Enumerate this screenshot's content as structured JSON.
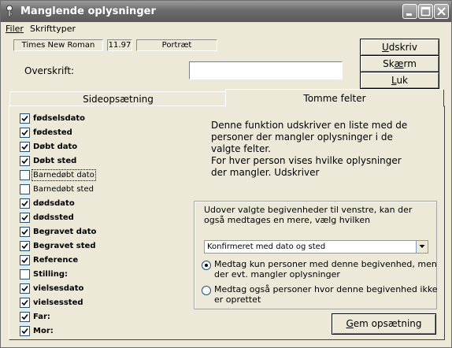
{
  "window": {
    "title": "Manglende oplysninger",
    "controls": [
      "minimize-icon",
      "maximize-icon",
      "close-icon"
    ]
  },
  "menu": [
    "Filer",
    "Skrifttyper"
  ],
  "font_info": {
    "name": "Times New Roman",
    "size": "11.97",
    "orientation": "Portræt"
  },
  "heading": {
    "label": "Overskrift:",
    "value": ""
  },
  "buttons": {
    "print": {
      "underlined": "U",
      "rest": "dskriv"
    },
    "screen": {
      "pre": "Sk",
      "underlined": "æ",
      "rest": "rm"
    },
    "close": {
      "underlined": "L",
      "rest": "uk"
    },
    "save": {
      "underlined": "G",
      "rest": "em opsætning"
    }
  },
  "tabs": [
    {
      "label": "Sideopsætning",
      "active": false
    },
    {
      "label": "Tomme felter",
      "active": true
    }
  ],
  "fields": [
    {
      "label": "fødselsdato",
      "checked": true,
      "bold": true
    },
    {
      "label": "fødested",
      "checked": true,
      "bold": true
    },
    {
      "label": "Døbt dato",
      "checked": true,
      "bold": true
    },
    {
      "label": "Døbt sted",
      "checked": true,
      "bold": true
    },
    {
      "label": "Barnedøbt dato",
      "checked": false,
      "bold": false,
      "focused": true
    },
    {
      "label": "Barnedøbt sted",
      "checked": false,
      "bold": false
    },
    {
      "label": "dødsdato",
      "checked": true,
      "bold": true
    },
    {
      "label": "dødssted",
      "checked": true,
      "bold": true
    },
    {
      "label": "Begravet dato",
      "checked": true,
      "bold": true
    },
    {
      "label": "Begravet sted",
      "checked": true,
      "bold": true
    },
    {
      "label": "Reference",
      "checked": true,
      "bold": true
    },
    {
      "label": "Stilling:",
      "checked": false,
      "bold": true
    },
    {
      "label": "vielsesdato",
      "checked": true,
      "bold": true
    },
    {
      "label": "vielsessted",
      "checked": true,
      "bold": true
    },
    {
      "label": "Far:",
      "checked": true,
      "bold": true
    },
    {
      "label": "Mor:",
      "checked": true,
      "bold": true
    }
  ],
  "description": "Denne funktion udskriver en liste med de\npersoner der mangler oplysninger i de\nvalgte felter.\nFor hver person vises hvilke oplysninger\nder mangler. Udskriver",
  "group": {
    "text": "Udover valgte begivenheder til venstre, kan der også medtages en mere, vælg hvilken",
    "selected_event": "Konfirmeret med dato og sted",
    "options": [
      {
        "label": "Medtag kun personer med denne begivenhed, men der evt. mangler oplysninger",
        "selected": true
      },
      {
        "label": "Medtag også personer hvor denne begivenhed ikke er oprettet",
        "selected": false
      }
    ]
  }
}
